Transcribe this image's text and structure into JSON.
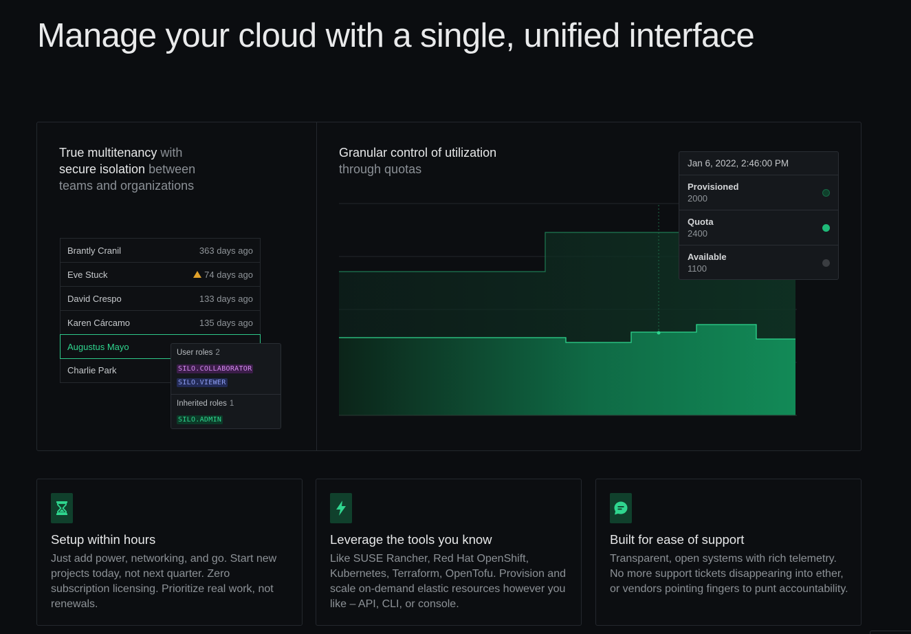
{
  "headline": "Manage your cloud with a single, unified interface",
  "multitenancy": {
    "part1": "True multitenancy",
    "part2": " with",
    "part3": "secure isolation",
    "part4": " between",
    "part5": "teams and organizations",
    "users": [
      {
        "name": "Brantly Cranil",
        "time": "363 days ago",
        "warning": false
      },
      {
        "name": "Eve Stuck",
        "time": "74 days ago",
        "warning": true
      },
      {
        "name": "David Crespo",
        "time": "133 days ago",
        "warning": false
      },
      {
        "name": "Karen Cárcamo",
        "time": "135 days ago",
        "warning": false
      },
      {
        "name": "Augustus Mayo",
        "time": "",
        "warning": false,
        "selected": true
      },
      {
        "name": "Charlie Park",
        "time": "",
        "warning": false
      }
    ],
    "popover": {
      "user_roles_label": "User roles",
      "user_roles_count": "2",
      "user_roles": [
        "SILO.COLLABORATOR",
        "SILO.VIEWER"
      ],
      "inherited_roles_label": "Inherited roles",
      "inherited_roles_count": "1",
      "inherited_roles": [
        "SILO.ADMIN"
      ]
    }
  },
  "utilization": {
    "title_line1": "Granular control of utilization",
    "title_line2": "through quotas",
    "tooltip": {
      "date": "Jan 6, 2022, 2:46:00 PM",
      "rows": [
        {
          "label": "Provisioned",
          "value": "2000",
          "dot_color": "#0f3f2b"
        },
        {
          "label": "Quota",
          "value": "2400",
          "dot_color": "#1fb978"
        },
        {
          "label": "Available",
          "value": "1100",
          "dot_color": "#3a3d41"
        }
      ]
    }
  },
  "cards": [
    {
      "icon": "hourglass-icon",
      "title": "Setup within hours",
      "body": "Just add power, networking, and go. Start new projects today, not next quarter. Zero subscription licensing. Prioritize real work, not renewals."
    },
    {
      "icon": "lightning-icon",
      "title": "Leverage the tools you know",
      "body": "Like SUSE Rancher, Red Hat OpenShift, Kubernetes, Terraform, OpenTofu. Provision and scale on-demand elastic resources however you like – API, CLI, or console."
    },
    {
      "icon": "chat-bubble-icon",
      "title": "Built for ease of support",
      "body": "Transparent, open systems with rich telemetry. No more support tickets disappearing into ether, or vendors pointing fingers to punt accountability."
    }
  ],
  "colors": {
    "accent": "#2fd68f",
    "background": "#0b0d10"
  }
}
